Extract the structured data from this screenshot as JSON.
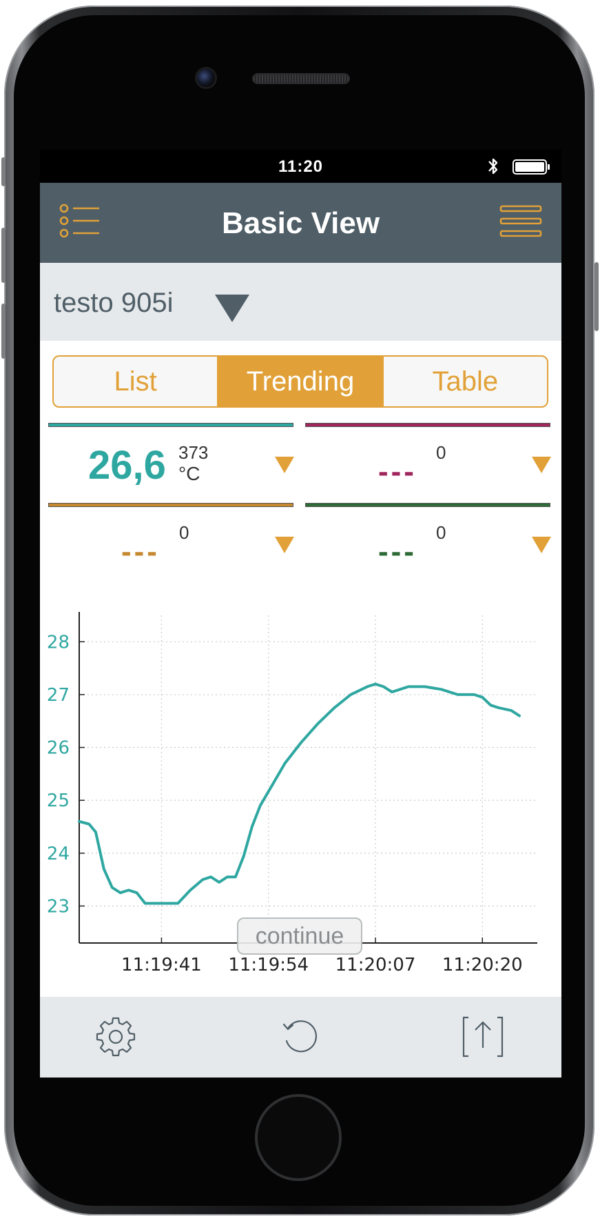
{
  "status_bar": {
    "time": "11:20"
  },
  "nav_bar": {
    "title": "Basic View"
  },
  "device_selector": {
    "name": "testo 905i"
  },
  "view_tabs": [
    {
      "label": "List",
      "active": false
    },
    {
      "label": "Trending",
      "active": true
    },
    {
      "label": "Table",
      "active": false
    }
  ],
  "channels": [
    {
      "color": "#2fa7a1",
      "value": "26,6",
      "count": "373",
      "unit": "°C"
    },
    {
      "color": "#a0265e",
      "value": "---",
      "count": "0"
    },
    {
      "color": "#c78930",
      "value": "---",
      "count": "0"
    },
    {
      "color": "#2e6b37",
      "value": "---",
      "count": "0"
    }
  ],
  "chart_data": {
    "type": "line",
    "ylim": [
      22.3,
      28.5
    ],
    "yticks": [
      "23",
      "24",
      "25",
      "26",
      "27",
      "28"
    ],
    "xticks": [
      "11:19:41",
      "11:19:54",
      "11:20:07",
      "11:20:20"
    ],
    "x_seconds_range": [
      0,
      54
    ],
    "x_tick_seconds": [
      10,
      23,
      36,
      49
    ],
    "grid": true,
    "series": [
      {
        "color": "#2fa7a1",
        "points": [
          [
            0,
            24.6
          ],
          [
            1.2,
            24.55
          ],
          [
            2,
            24.4
          ],
          [
            3,
            23.7
          ],
          [
            4,
            23.35
          ],
          [
            5,
            23.25
          ],
          [
            6,
            23.3
          ],
          [
            7,
            23.25
          ],
          [
            8,
            23.05
          ],
          [
            10,
            23.05
          ],
          [
            12,
            23.05
          ],
          [
            13.5,
            23.3
          ],
          [
            15,
            23.5
          ],
          [
            16,
            23.55
          ],
          [
            17,
            23.45
          ],
          [
            18,
            23.55
          ],
          [
            19,
            23.55
          ],
          [
            20,
            23.95
          ],
          [
            21,
            24.5
          ],
          [
            22,
            24.9
          ],
          [
            23.5,
            25.3
          ],
          [
            25,
            25.7
          ],
          [
            27,
            26.1
          ],
          [
            29,
            26.45
          ],
          [
            31,
            26.75
          ],
          [
            33,
            27.0
          ],
          [
            35,
            27.15
          ],
          [
            36,
            27.2
          ],
          [
            37,
            27.15
          ],
          [
            38,
            27.05
          ],
          [
            39,
            27.1
          ],
          [
            40,
            27.15
          ],
          [
            42,
            27.15
          ],
          [
            44,
            27.1
          ],
          [
            46,
            27.0
          ],
          [
            48,
            27.0
          ],
          [
            49,
            26.95
          ],
          [
            50,
            26.8
          ],
          [
            51,
            26.75
          ],
          [
            52.5,
            26.7
          ],
          [
            53.5,
            26.6
          ]
        ]
      }
    ]
  },
  "chart_overlay": {
    "continue_label": "continue"
  },
  "bottom_bar": {
    "icons": [
      "gear-icon",
      "refresh-icon",
      "export-icon"
    ]
  },
  "theme": {
    "accent": "#e1a138",
    "nav": "#4f5e67",
    "panel": "#e6e9ec"
  }
}
